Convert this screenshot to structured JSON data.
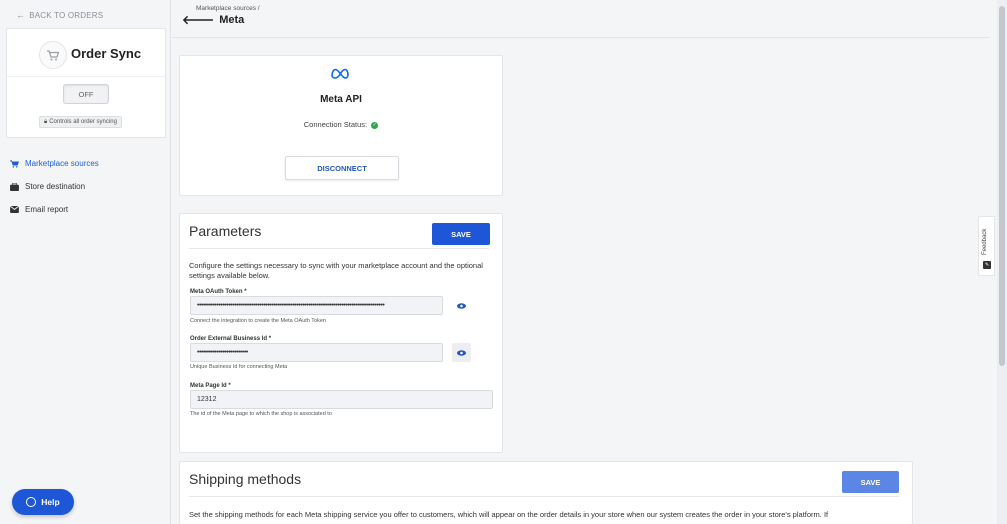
{
  "sidebar": {
    "back_label": "BACK TO ORDERS",
    "app_title": "Order Sync",
    "toggle_state": "OFF",
    "controls_note": "Controls all order syncing",
    "items": [
      {
        "label": "Marketplace sources",
        "icon": "cart-icon",
        "active": true
      },
      {
        "label": "Store destination",
        "icon": "briefcase-icon",
        "active": false
      },
      {
        "label": "Email report",
        "icon": "envelope-icon",
        "active": false
      }
    ]
  },
  "header": {
    "breadcrumb": "Marketplace sources /",
    "title": "Meta"
  },
  "meta_card": {
    "name": "Meta API",
    "connection_label": "Connection Status:",
    "connection_ok": true,
    "disconnect_label": "DISCONNECT"
  },
  "parameters": {
    "title": "Parameters",
    "save_label": "SAVE",
    "description": "Configure the settings necessary to sync with your marketplace account and the optional settings available below.",
    "fields": [
      {
        "label": "Meta OAuth Token *",
        "value": "••••••••••••••••••••••••••••••••••••••••••••••••••••••••••••••••••••••••••••••••••••••••••••••••",
        "help": "Connect the integration to create the Meta OAuth Token"
      },
      {
        "label": "Order External Business Id *",
        "value": "••••••••••••••••••••••••••",
        "help": "Unique Business Id for connecting Meta"
      },
      {
        "label": "Meta Page Id *",
        "value": "12312",
        "help": "The id of the Meta page to which the shop is associated to"
      }
    ]
  },
  "shipping": {
    "title": "Shipping methods",
    "save_label": "SAVE",
    "description": "Set the shipping methods for each Meta shipping service you offer to customers, which will appear on the order details in your store when our system creates the order in your store's platform. If"
  },
  "feedback_label": "Feedback",
  "help_label": "Help",
  "colors": {
    "accent": "#1d56d6",
    "success": "#2ea44f",
    "meta_blue": "#0866ff"
  }
}
